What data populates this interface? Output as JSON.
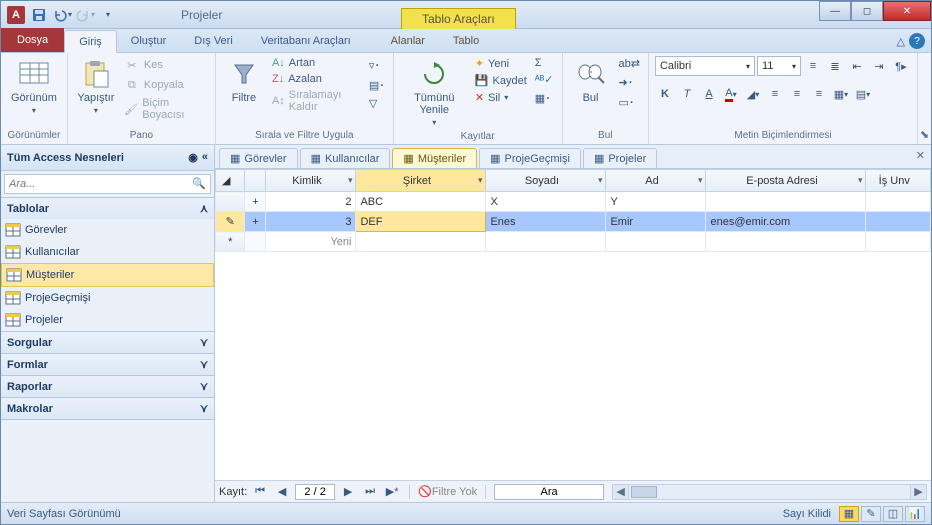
{
  "title": "Projeler",
  "tool_context": "Tablo Araçları",
  "file_tab": "Dosya",
  "tabs": [
    "Giriş",
    "Oluştur",
    "Dış Veri",
    "Veritabanı Araçları"
  ],
  "tool_tabs": [
    "Alanlar",
    "Tablo"
  ],
  "ribbon": {
    "view": "Görünüm",
    "views_label": "Görünümler",
    "paste": "Yapıştır",
    "cut": "Kes",
    "copy": "Kopyala",
    "format_painter": "Biçim Boyacısı",
    "clipboard_label": "Pano",
    "filter": "Filtre",
    "asc": "Artan",
    "desc": "Azalan",
    "clear_sort": "Sıralamayı Kaldır",
    "sort_label": "Sırala ve Filtre Uygula",
    "refresh": "Tümünü Yenile",
    "new": "Yeni",
    "save": "Kaydet",
    "delete": "Sil",
    "records_label": "Kayıtlar",
    "find": "Bul",
    "find_label": "Bul",
    "font": "Calibri",
    "size": "11",
    "format_label": "Metin Biçimlendirmesi"
  },
  "nav": {
    "title": "Tüm Access Nesneleri",
    "search_placeholder": "Ara...",
    "groups": {
      "tables": "Tablolar",
      "queries": "Sorgular",
      "forms": "Formlar",
      "reports": "Raporlar",
      "macros": "Makrolar"
    },
    "tables": [
      "Görevler",
      "Kullanıcılar",
      "Müşteriler",
      "ProjeGeçmişi",
      "Projeler"
    ]
  },
  "doc_tabs": [
    "Görevler",
    "Kullanıcılar",
    "Müşteriler",
    "ProjeGeçmişi",
    "Projeler"
  ],
  "active_doc": "Müşteriler",
  "columns": [
    "Kimlik",
    "Şirket",
    "Soyadı",
    "Ad",
    "E-posta Adresi",
    "İş Unv"
  ],
  "rows": [
    {
      "id": "2",
      "company": "ABC",
      "last": "X",
      "first": "Y",
      "email": ""
    },
    {
      "id": "3",
      "company": "DEF",
      "last": "Enes",
      "first": "Emir",
      "email": "enes@emir.com"
    }
  ],
  "new_row_label": "Yeni",
  "recnav": {
    "label": "Kayıt:",
    "pos": "2 / 2",
    "nofilter": "Filtre Yok",
    "search": "Ara"
  },
  "status": {
    "left": "Veri Sayfası Görünümü",
    "lock": "Sayı Kilidi"
  }
}
